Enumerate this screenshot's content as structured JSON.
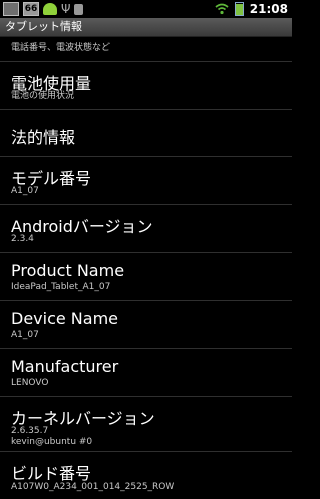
{
  "status_bar": {
    "notification_count": "66",
    "time": "21:08"
  },
  "title_bar": {
    "title": "タブレット情報"
  },
  "list": {
    "partial_subtitle": "電話番号、電波状態など",
    "items": [
      {
        "title": "電池使用量",
        "subtitle": "電池の使用状況"
      },
      {
        "title": "法的情報",
        "subtitle": ""
      },
      {
        "title": "モデル番号",
        "subtitle": "A1_07"
      },
      {
        "title": "Androidバージョン",
        "subtitle": "2.3.4"
      },
      {
        "title": "Product Name",
        "subtitle": "IdeaPad_Tablet_A1_07"
      },
      {
        "title": "Device Name",
        "subtitle": "A1_07"
      },
      {
        "title": "Manufacturer",
        "subtitle": "LENOVO"
      },
      {
        "title": "カーネルバージョン",
        "subtitle": "2.6.35.7",
        "subtitle2": "kevin@ubuntu #0"
      },
      {
        "title": "ビルド番号",
        "subtitle": "A107W0_A234_001_014_2525_ROW"
      }
    ]
  }
}
